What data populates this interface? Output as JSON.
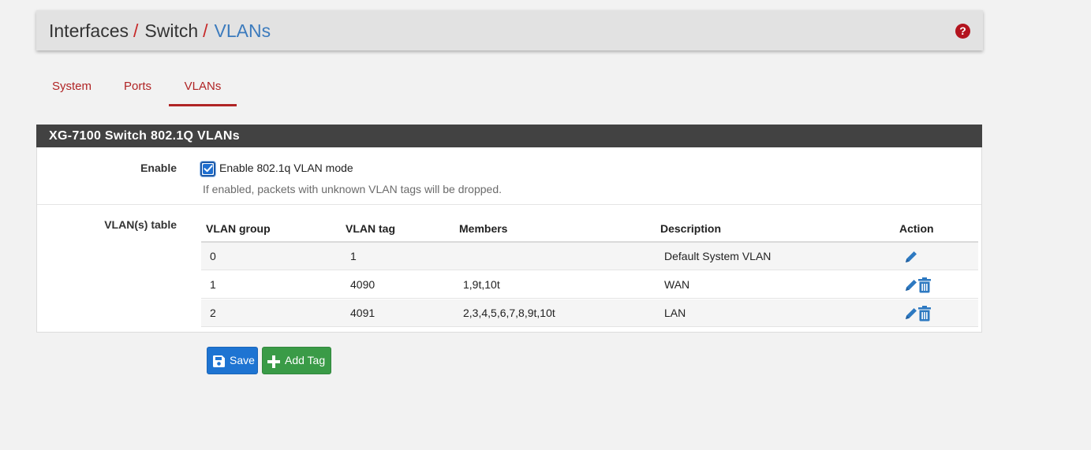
{
  "breadcrumb": {
    "items": [
      "Interfaces",
      "Switch",
      "VLANs"
    ],
    "separator": "/"
  },
  "help_icon": "question-circle-icon",
  "tabs": [
    {
      "label": "System",
      "active": false
    },
    {
      "label": "Ports",
      "active": false
    },
    {
      "label": "VLANs",
      "active": true
    }
  ],
  "panel": {
    "title": "XG-7100 Switch 802.1Q VLANs",
    "enable": {
      "label": "Enable",
      "checkbox_label": "Enable 802.1q VLAN mode",
      "checked": true,
      "help": "If enabled, packets with unknown VLAN tags will be dropped."
    },
    "vlan_table": {
      "label": "VLAN(s) table",
      "columns": [
        "VLAN group",
        "VLAN tag",
        "Members",
        "Description",
        "Action"
      ],
      "rows": [
        {
          "group": "0",
          "tag": "1",
          "members": "",
          "description": "Default System VLAN",
          "actions": [
            "edit"
          ]
        },
        {
          "group": "1",
          "tag": "4090",
          "members": "1,9t,10t",
          "description": "WAN",
          "actions": [
            "edit",
            "delete"
          ]
        },
        {
          "group": "2",
          "tag": "4091",
          "members": "2,3,4,5,6,7,8,9t,10t",
          "description": "LAN",
          "actions": [
            "edit",
            "delete"
          ]
        }
      ]
    }
  },
  "buttons": {
    "save": {
      "label": "Save",
      "icon": "save-icon"
    },
    "add": {
      "label": "Add Tag",
      "icon": "plus-icon"
    }
  },
  "colors": {
    "accent_red": "#b02425",
    "link_blue": "#3c7bbd",
    "header_dark": "#424242",
    "save_blue": "#1e74d2",
    "add_green": "#3a9b47",
    "action_blue": "#2d79c1"
  }
}
